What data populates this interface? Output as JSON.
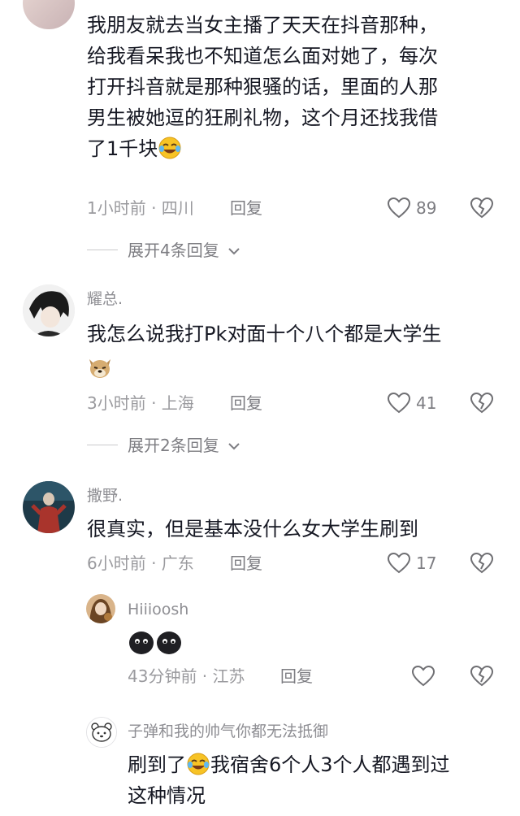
{
  "comments": [
    {
      "username": "",
      "text": "我朋友就去当女主播了天天在抖音那种，给我看呆我也不知道怎么面对她了，每次打开抖音就是那种狠骚的话，里面的人那男生被她逗的狂刷礼物，这个月还找我借了1千块",
      "lines": [
        "我朋友就去当女主播了天天在抖音那种，",
        "给我看呆我也不知道怎么面对她了，每次",
        "打开抖音就是那种狠骚的话，里面的人那",
        "男生被她逗的狂刷礼物，这个月还找我借",
        "了1千块"
      ],
      "emoji": "laugh-cry-emoji",
      "meta": "1小时前 · 四川",
      "reply": "回复",
      "likes": "89",
      "expand": "展开4条回复"
    },
    {
      "username": "耀总.",
      "text": "我怎么说我打Pk对面十个八个都是大学生",
      "emoji": "dog-emoji",
      "meta": "3小时前 · 上海",
      "reply": "回复",
      "likes": "41",
      "expand": "展开2条回复"
    },
    {
      "username": "撒野.",
      "text": "很真实，但是基本没什么女大学生刷到",
      "meta": "6小时前 · 广东",
      "reply": "回复",
      "likes": "17"
    }
  ],
  "replies": [
    {
      "username": "Hiiioosh",
      "emoji": "black-blob-emoji",
      "meta": "43分钟前 · 江苏",
      "reply": "回复"
    },
    {
      "username": "子弹和我的帅气你都无法抵御",
      "text_before": "刷到了",
      "emoji": "laugh-cry-emoji",
      "text_after": "我宿舍6个人3个人都遇到过",
      "line2": "这种情况"
    }
  ],
  "colors": {
    "text": "#161823",
    "meta": "#9a9a9e",
    "icon": "#7d7d82"
  }
}
